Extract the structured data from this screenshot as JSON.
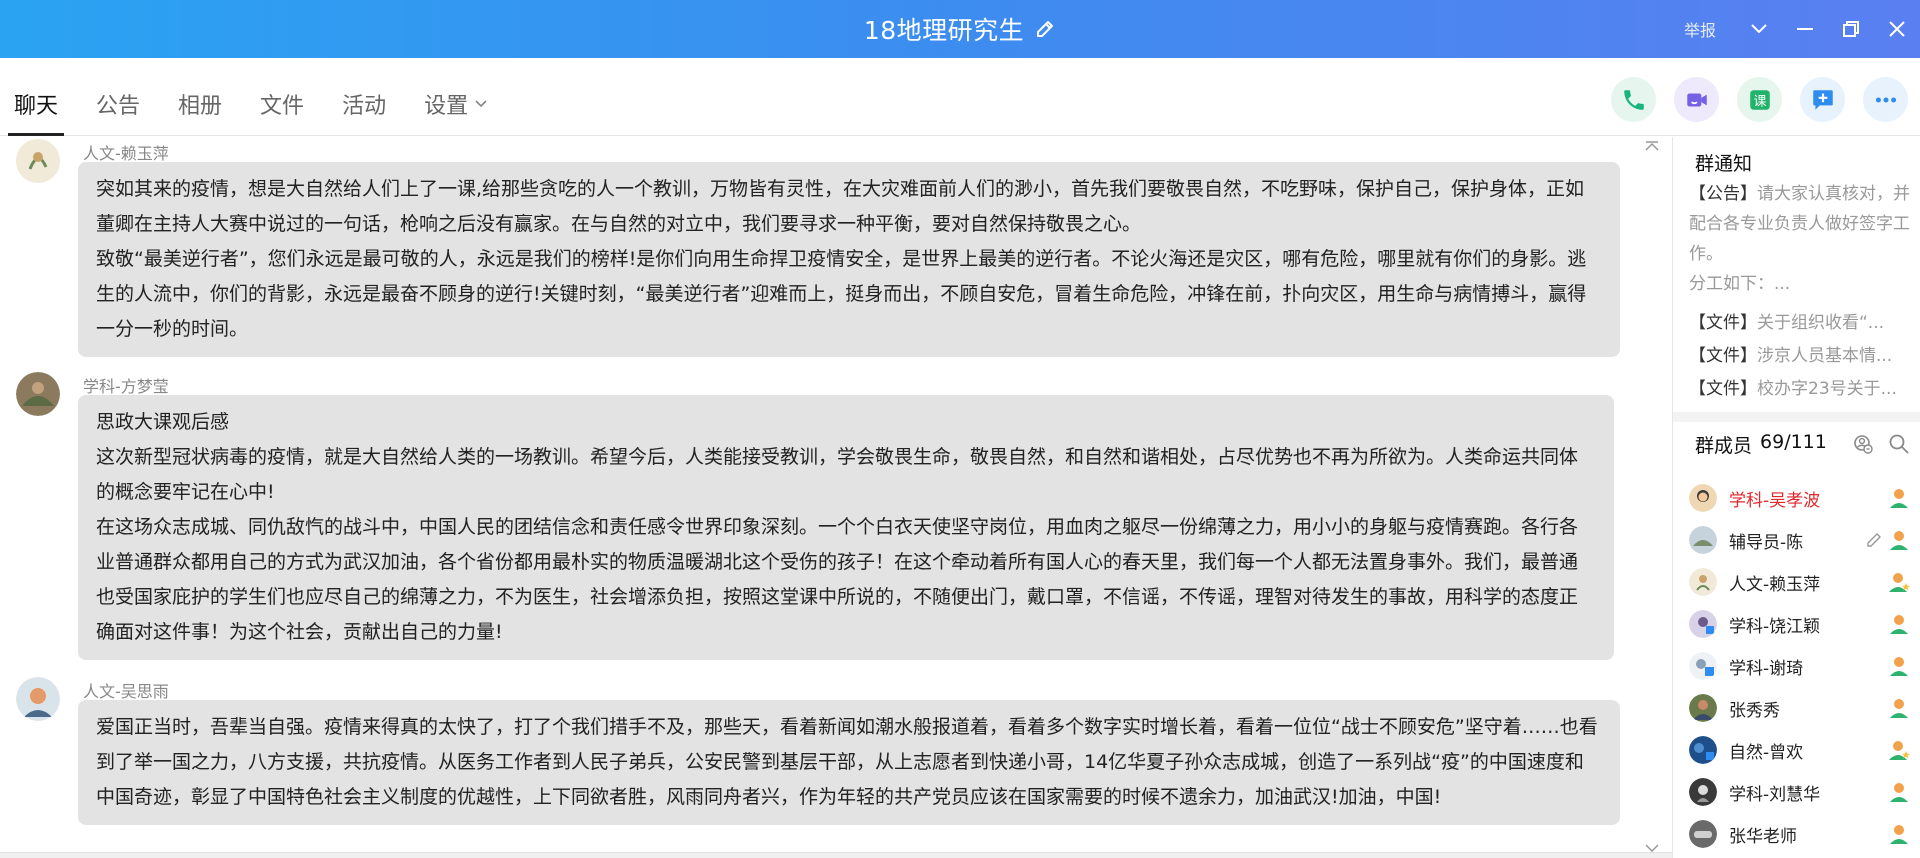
{
  "titlebar": {
    "title": "18地理研究生",
    "report_label": "举报"
  },
  "tabs": [
    {
      "label": "聊天",
      "active": true
    },
    {
      "label": "公告"
    },
    {
      "label": "相册"
    },
    {
      "label": "文件"
    },
    {
      "label": "活动"
    },
    {
      "label": "设置"
    }
  ],
  "action_icons": [
    "phone-icon",
    "video-icon",
    "course-icon",
    "add-app-icon",
    "more-icon"
  ],
  "action_colors": {
    "phone": "#19b37d",
    "video": "#7561e6",
    "course": "#21b36b",
    "add": "#2f8cf0",
    "more": "#2f8cf0"
  },
  "messages": [
    {
      "sender": "人文-赖玉萍",
      "paragraphs": [
        "突如其来的疫情，想是大自然给人们上了一课,给那些贪吃的人一个教训，万物皆有灵性，在大灾难面前人们的渺小，首先我们要敬畏自然，不吃野味，保护自己，保护身体，正如董卿在主持人大赛中说过的一句话，枪响之后没有赢家。在与自然的对立中，我们要寻求一种平衡，要对自然保持敬畏之心。",
        "致敬“最美逆行者”，您们永远是最可敬的人，永远是我们的榜样!是你们向用生命捍卫疫情安全，是世界上最美的逆行者。不论火海还是灾区，哪有危险，哪里就有你们的身影。逃生的人流中，你们的背影，永远是最奋不顾身的逆行!关键时刻，“最美逆行者”迎难而上，挺身而出，不顾自安危，冒着生命危险，冲锋在前，扑向灾区，用生命与病情搏斗，赢得一分一秒的时间。"
      ]
    },
    {
      "sender": "学科-方梦莹",
      "paragraphs": [
        "思政大课观后感",
        "这次新型冠状病毒的疫情，就是大自然给人类的一场教训。希望今后，人类能接受教训，学会敬畏生命，敬畏自然，和自然和谐相处，占尽优势也不再为所欲为。人类命运共同体的概念要牢记在心中!",
        "在这场众志成城、同仇敌忾的战斗中，中国人民的团结信念和责任感令世界印象深刻。一个个白衣天使坚守岗位，用血肉之躯尽一份绵薄之力，用小小的身躯与疫情赛跑。各行各业普通群众都用自己的方式为武汉加油，各个省份都用最朴实的物质温暖湖北这个受伤的孩子！在这个牵动着所有国人心的春天里，我们每一个人都无法置身事外。我们，最普通也受国家庇护的学生们也应尽自己的绵薄之力，不为医生，社会增添负担，按照这堂课中所说的，不随便出门，戴口罩，不信谣，不传谣，理智对待发生的事故，用科学的态度正确面对这件事！为这个社会，贡献出自己的力量!"
      ]
    },
    {
      "sender": "人文-吴思雨",
      "paragraphs": [
        "爱国正当时，吾辈当自强。疫情来得真的太快了，打了个我们措手不及，那些天，看着新闻如潮水般报道着，看着多个数字实时增长着，看着一位位“战士不顾安危”坚守着……也看到了举一国之力，八方支援，共抗疫情。从医务工作者到人民子弟兵，公安民警到基层干部，从上志愿者到快递小哥，14亿华夏子孙众志成城，创造了一系列战“疫”的中国速度和中国奇迹，彰显了中国特色社会主义制度的优越性，上下同欲者胜，风雨同舟者兴，作为年轻的共产党员应该在国家需要的时候不遗余力，加油武汉!加油，中国!"
      ]
    }
  ],
  "notice": {
    "title": "群通知",
    "announcement_tag": "【公告】",
    "announcement_text": "请大家认真核对，并配合各专业负责人做好签字工作。",
    "announcement_more": "分工如下：...",
    "files": [
      {
        "tag": "【文件】",
        "name": "关于组织收看“..."
      },
      {
        "tag": "【文件】",
        "name": "涉京人员基本情..."
      },
      {
        "tag": "【文件】",
        "name": "校办字23号关于..."
      }
    ]
  },
  "members": {
    "label": "群成员",
    "count": "69/111",
    "list": [
      {
        "name": "学科-吴孝波",
        "highlight": true
      },
      {
        "name": "辅导员-陈"
      },
      {
        "name": "人文-赖玉萍"
      },
      {
        "name": "学科-饶江颖"
      },
      {
        "name": "学科-谢琦"
      },
      {
        "name": "张秀秀"
      },
      {
        "name": "自然-曾欢"
      },
      {
        "name": "学科-刘慧华"
      },
      {
        "name": "张华老师"
      }
    ]
  }
}
